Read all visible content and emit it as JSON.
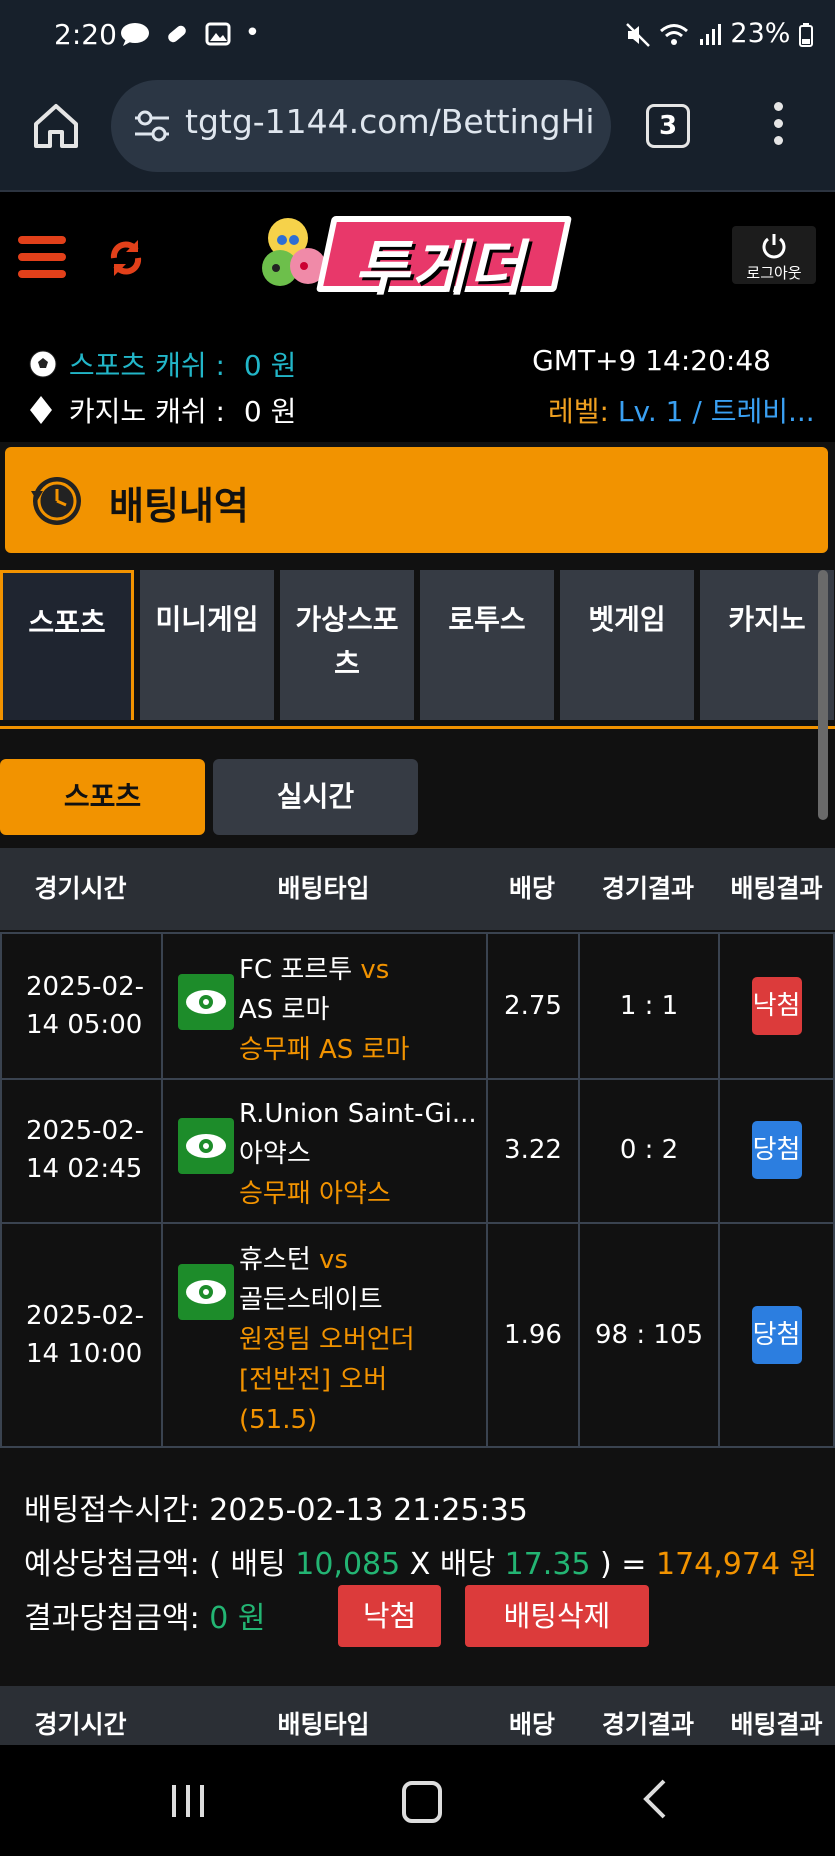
{
  "statusbar": {
    "time": "2:20",
    "battery": "23%",
    "icons": [
      "chat-icon",
      "pill-icon",
      "image-icon",
      "dot-icon",
      "battery-saver-icon",
      "mute-icon",
      "wifi-icon",
      "volte-icon",
      "signal-icon",
      "battery-icon"
    ]
  },
  "browser": {
    "url": "tgtg-1144.com/BettingHi",
    "tab_count": "3"
  },
  "header": {
    "logo_text": "투게더",
    "logout_label": "로그아웃",
    "sport_cash_label": "스포츠 캐쉬 :",
    "sport_cash_value": "0 원",
    "casino_cash_label": "카지노 캐쉬 :",
    "casino_cash_value": "0 원",
    "gmt": "GMT+9 14:20:48",
    "level_label": "레벨:",
    "level_value": "Lv. 1 / 트레비..."
  },
  "title": "배팅내역",
  "categories": [
    "스포츠",
    "미니게임",
    "가상스포츠",
    "로투스",
    "벳게임",
    "카지노"
  ],
  "subtabs": [
    "스포츠",
    "실시간"
  ],
  "columns": [
    "경기시간",
    "배팅타입",
    "배당",
    "경기결과",
    "배팅결과"
  ],
  "rows": [
    {
      "time1": "2025-02-",
      "time2": "14 05:00",
      "team1": "FC 포르투",
      "vs": "vs",
      "team2": "AS 로마",
      "pick": [
        "승무패 AS 로마"
      ],
      "odds": "2.75",
      "score": "1 : 1",
      "outcome": "낙첨"
    },
    {
      "time1": "2025-02-",
      "time2": "14 02:45",
      "team1": "R.Union Saint-Gi...",
      "vs": "",
      "team2": "아약스",
      "pick": [
        "승무패 아약스"
      ],
      "odds": "3.22",
      "score": "0 : 2",
      "outcome": "당첨"
    },
    {
      "time1": "2025-02-",
      "time2": "14 10:00",
      "team1": "휴스턴",
      "vs": "vs",
      "team2": "골든스테이트",
      "pick": [
        "원정팀 오버언더",
        "[전반전] 오버",
        "(51.5)"
      ],
      "odds": "1.96",
      "score": "98 : 105",
      "outcome": "당첨"
    }
  ],
  "summary": {
    "accept_label": "배팅접수시간:",
    "accept_time": "2025-02-13 21:25:35",
    "expected_label": "예상당첨금액: ( 배팅",
    "bet_amount": "10,085",
    "x_label": "X 배당",
    "total_odds": "17.35",
    "eq_label": ") =",
    "expected_amount": "174,974 원",
    "result_label": "결과당첨금액:",
    "result_amount": "0 원",
    "status_button": "낙첨",
    "delete_button": "배팅삭제"
  },
  "colors": {
    "accent": "#f29300",
    "win": "#2c7ee0",
    "lose": "#dc3b3b",
    "green": "#23b573",
    "cyan": "#22b6c8"
  }
}
